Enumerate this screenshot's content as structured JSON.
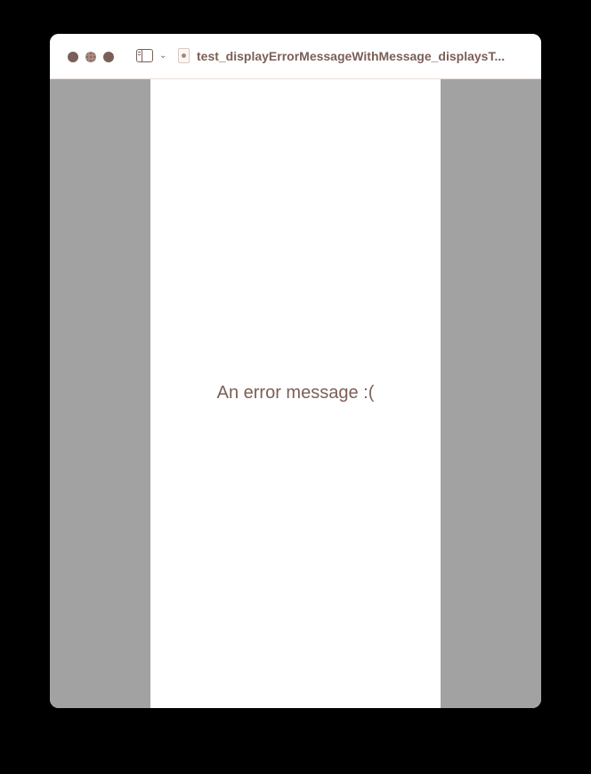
{
  "window": {
    "title": "test_displayErrorMessageWithMessage_displaysT..."
  },
  "toolbar": {
    "sidebar_icon": "sidebar-toggle-icon",
    "chevron_icon": "chevron-down-icon",
    "chevron_glyph": "⌄",
    "document_icon": "swift-file-icon"
  },
  "preview": {
    "error_message": "An error message :("
  },
  "colors": {
    "accent": "#7b5f57",
    "side_background": "#a2a2a2",
    "device_background": "#ffffff"
  }
}
